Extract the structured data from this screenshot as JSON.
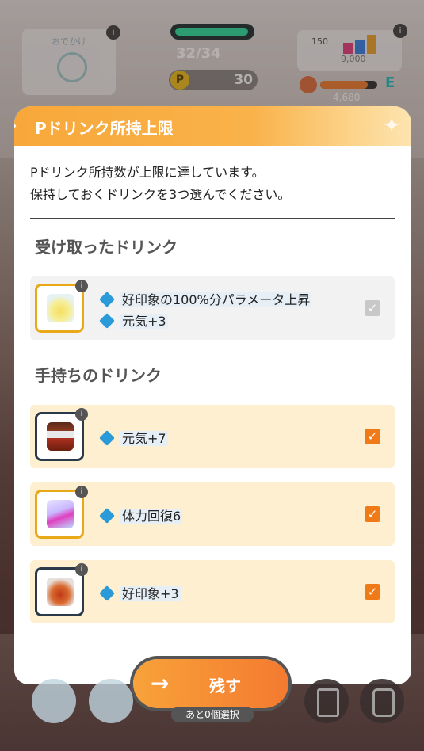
{
  "hud": {
    "outing_label": "おでかけ",
    "stamina": "32/34",
    "p_coin_glyph": "P",
    "p_points": "30",
    "right_count": "150",
    "right_fans": "9,000",
    "level_letter": "E",
    "exp": "4,680",
    "info_glyph": "i"
  },
  "modal": {
    "title": "Pドリンク所持上限",
    "message_line1": "Pドリンク所持数が上限に達しています。",
    "message_line2": "保持しておくドリンクを3つ選んでください。",
    "received_heading": "受け取ったドリンク",
    "owned_heading": "手持ちのドリンク",
    "received": [
      {
        "effects": [
          "好印象の100%分パラメータ上昇",
          "元気+3"
        ],
        "checked": true,
        "disabled": true
      }
    ],
    "owned": [
      {
        "effects": [
          "元気+7"
        ],
        "checked": true
      },
      {
        "effects": [
          "体力回復6"
        ],
        "checked": true
      },
      {
        "effects": [
          "好印象+3"
        ],
        "checked": true
      }
    ]
  },
  "footer": {
    "keep_label": "残す",
    "remaining": "あと0個選択"
  },
  "colors": {
    "accent": "#f47a30",
    "header": "#f8a83a",
    "selected_row": "#fdefcf",
    "effect_icon": "#2a9ad8"
  }
}
